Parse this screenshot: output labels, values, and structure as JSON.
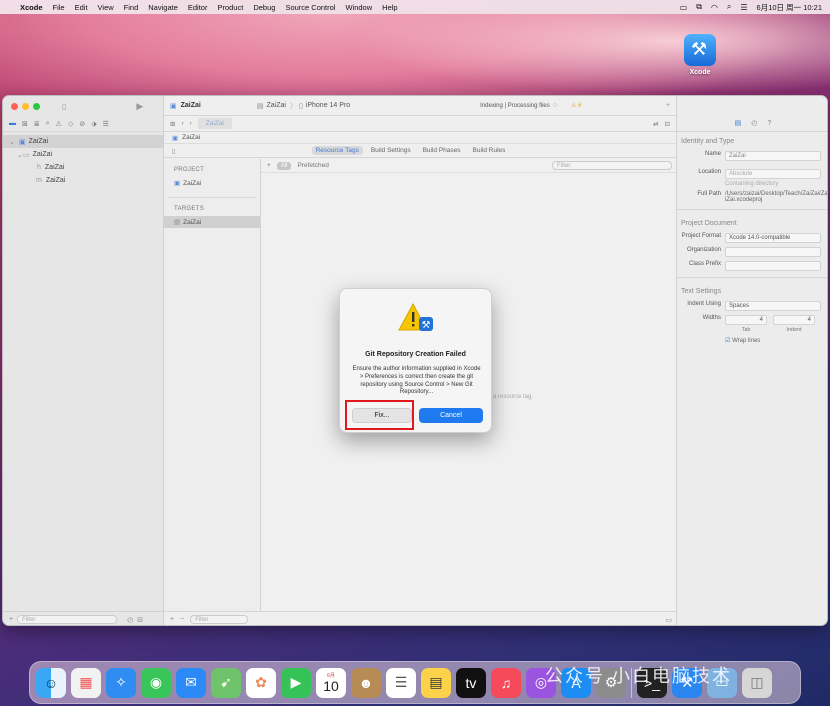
{
  "menubar": {
    "app_name": "Xcode",
    "items": [
      "File",
      "Edit",
      "View",
      "Find",
      "Navigate",
      "Editor",
      "Product",
      "Debug",
      "Source Control",
      "Window",
      "Help"
    ],
    "clock": "6月10日 周一 10:21"
  },
  "desktop_icon": {
    "label": "Xcode"
  },
  "window": {
    "title": "ZaiZai",
    "scheme": "ZaiZai",
    "device": "iPhone 14 Pro",
    "status": "Indexing | Processing files",
    "warnings": "6",
    "tab_label": "ZaiZai",
    "jump_bar": "ZaiZai"
  },
  "navigator": {
    "tree": [
      {
        "label": "ZaiZai",
        "level": 0
      },
      {
        "label": "ZaiZai",
        "level": 1
      },
      {
        "label": "ZaiZai",
        "level": 2,
        "prefix": "h"
      },
      {
        "label": "ZaiZai",
        "level": 2,
        "prefix": "m"
      }
    ],
    "filter_placeholder": "Filter"
  },
  "editor": {
    "segments": [
      "Resource Tags",
      "Build Settings",
      "Build Phases",
      "Build Rules"
    ],
    "active_segment": 0,
    "project_header": "PROJECT",
    "project_item": "ZaiZai",
    "targets_header": "TARGETS",
    "target_item": "ZaiZai",
    "filter_chip": "All",
    "filter_label": "Prefetched",
    "filter_placeholder": "Filter",
    "empty_hint": "d a resource tag.",
    "bottom_filter_placeholder": "Filter"
  },
  "inspector": {
    "identity_title": "Identity and Type",
    "name_label": "Name",
    "name_value": "ZaiZai",
    "location_label": "Location",
    "location_value": "Absolute",
    "location_sub": "Containing directory",
    "fullpath_label": "Full Path",
    "fullpath_value": "/Users/zaizai/Desktop/Teach/ZaiZai/ZaiZai.xcodeproj",
    "project_doc_title": "Project Document",
    "format_label": "Project Format",
    "format_value": "Xcode 14.0-compatible",
    "org_label": "Organization",
    "class_label": "Class Prefix",
    "text_settings_title": "Text Settings",
    "indent_label": "Indent Using",
    "indent_value": "Spaces",
    "widths_label": "Widths",
    "tab_value": "4",
    "indent_width_value": "4",
    "tab_caption": "Tab",
    "indent_caption": "Indent",
    "wrap_label": "Wrap lines"
  },
  "dialog": {
    "title": "Git Repository Creation Failed",
    "message": "Ensure the author information supplied in Xcode > Preferences is correct then create the git repository using Source Control > New Git Repository...",
    "fix_label": "Fix...",
    "cancel_label": "Cancel"
  },
  "dock": {
    "calendar_month": "6月",
    "calendar_day": "10",
    "watermark": "公众号 小白电脑技术"
  }
}
